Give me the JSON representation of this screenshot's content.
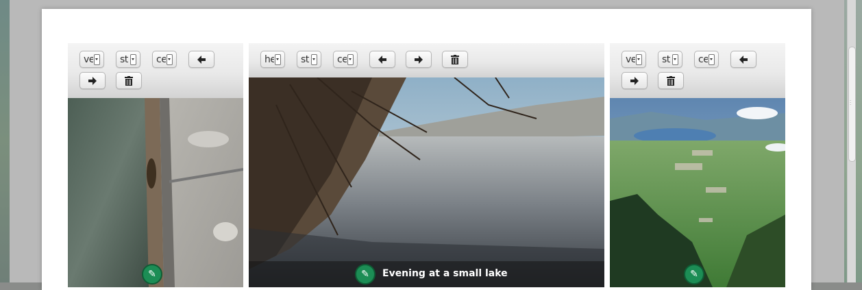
{
  "gallery": {
    "photos": [
      {
        "selects": [
          {
            "value": "ve"
          },
          {
            "value": "st"
          },
          {
            "value": "ce"
          }
        ],
        "buttons": [
          "arrow-left-icon",
          "arrow-right-icon",
          "trash-icon"
        ],
        "caption": ""
      },
      {
        "selects": [
          {
            "value": "he"
          },
          {
            "value": "st"
          },
          {
            "value": "ce"
          }
        ],
        "buttons": [
          "arrow-left-icon",
          "arrow-right-icon",
          "trash-icon"
        ],
        "caption": "Evening at a small lake"
      },
      {
        "selects": [
          {
            "value": "ve"
          },
          {
            "value": "st"
          },
          {
            "value": "ce"
          }
        ],
        "buttons": [
          "arrow-left-icon",
          "arrow-right-icon",
          "trash-icon"
        ],
        "caption": ""
      }
    ]
  },
  "colors": {
    "edit_badge": "#1c8d55",
    "modal_background": "#ffffff"
  }
}
